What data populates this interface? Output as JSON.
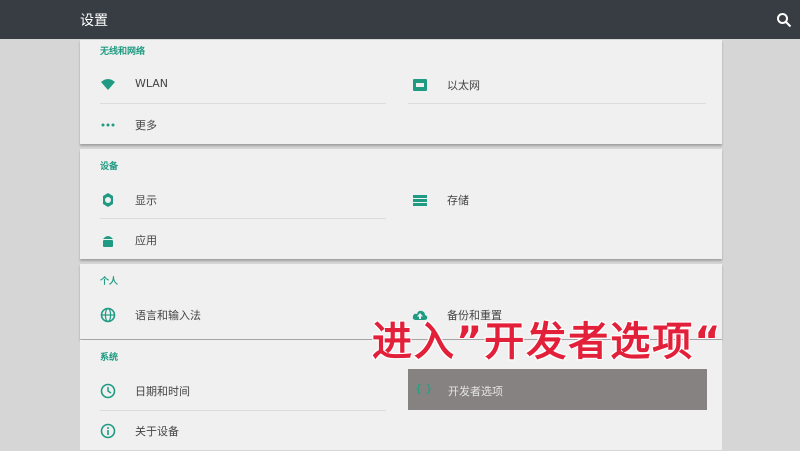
{
  "header": {
    "title": "设置",
    "search_icon": "search-icon"
  },
  "sections": {
    "wireless": {
      "title": "无线和网络",
      "wlan": "WLAN",
      "ethernet": "以太网",
      "more": "更多"
    },
    "device": {
      "title": "设备",
      "display": "显示",
      "storage": "存储",
      "apps": "应用"
    },
    "personal": {
      "title": "个人",
      "language": "语言和输入法",
      "backup": "备份和重置"
    },
    "system": {
      "title": "系统",
      "datetime": "日期和时间",
      "developer": "开发者选项",
      "about": "关于设备"
    }
  },
  "annotation": "进入”开发者选项“",
  "colors": {
    "accent": "#1f9b83",
    "topbar": "#373d43",
    "annotation": "#e3203a"
  }
}
